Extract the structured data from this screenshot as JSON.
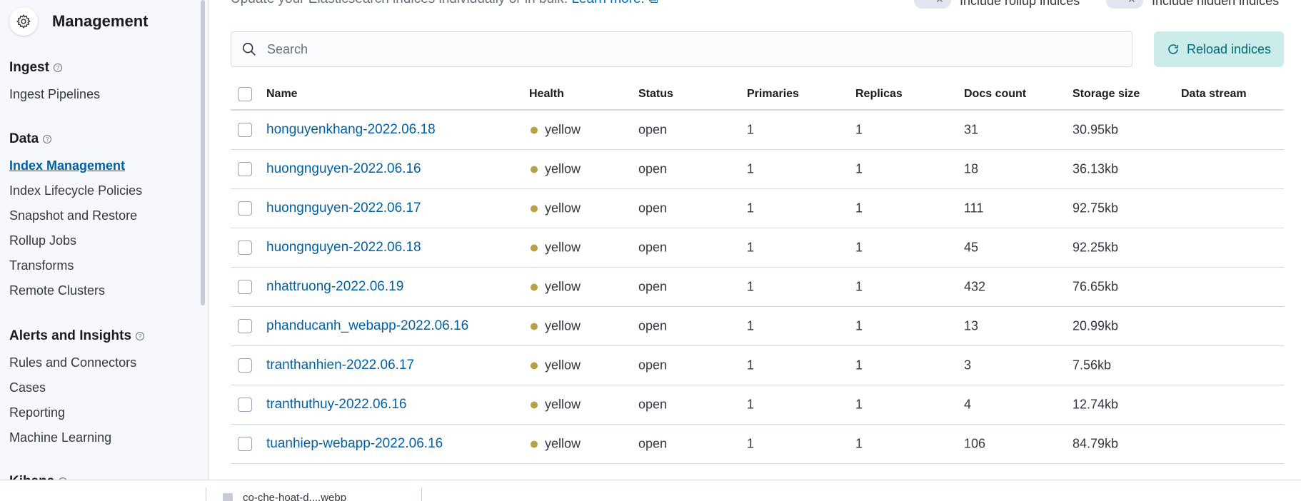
{
  "sidebar": {
    "title": "Management",
    "sections": [
      {
        "label": "Ingest",
        "items": [
          "Ingest Pipelines"
        ]
      },
      {
        "label": "Data",
        "items": [
          "Index Management",
          "Index Lifecycle Policies",
          "Snapshot and Restore",
          "Rollup Jobs",
          "Transforms",
          "Remote Clusters"
        ]
      },
      {
        "label": "Alerts and Insights",
        "items": [
          "Rules and Connectors",
          "Cases",
          "Reporting",
          "Machine Learning"
        ]
      },
      {
        "label": "Kibana",
        "items": []
      }
    ],
    "active_item": "Index Management"
  },
  "header": {
    "description": "Update your Elasticsearch indices individually or in bulk.",
    "learn_more": "Learn more.",
    "toggle_rollup": "Include rollup indices",
    "toggle_hidden": "Include hidden indices"
  },
  "search": {
    "placeholder": "Search"
  },
  "reload_button": "Reload indices",
  "table": {
    "columns": [
      "Name",
      "Health",
      "Status",
      "Primaries",
      "Replicas",
      "Docs count",
      "Storage size",
      "Data stream"
    ],
    "rows": [
      {
        "name": "honguyenkhang-2022.06.18",
        "health": "yellow",
        "status": "open",
        "primaries": "1",
        "replicas": "1",
        "docs": "31",
        "size": "30.95kb",
        "stream": ""
      },
      {
        "name": "huongnguyen-2022.06.16",
        "health": "yellow",
        "status": "open",
        "primaries": "1",
        "replicas": "1",
        "docs": "18",
        "size": "36.13kb",
        "stream": ""
      },
      {
        "name": "huongnguyen-2022.06.17",
        "health": "yellow",
        "status": "open",
        "primaries": "1",
        "replicas": "1",
        "docs": "111",
        "size": "92.75kb",
        "stream": ""
      },
      {
        "name": "huongnguyen-2022.06.18",
        "health": "yellow",
        "status": "open",
        "primaries": "1",
        "replicas": "1",
        "docs": "45",
        "size": "92.25kb",
        "stream": ""
      },
      {
        "name": "nhattruong-2022.06.19",
        "health": "yellow",
        "status": "open",
        "primaries": "1",
        "replicas": "1",
        "docs": "432",
        "size": "76.65kb",
        "stream": ""
      },
      {
        "name": "phanducanh_webapp-2022.06.16",
        "health": "yellow",
        "status": "open",
        "primaries": "1",
        "replicas": "1",
        "docs": "13",
        "size": "20.99kb",
        "stream": ""
      },
      {
        "name": "tranthanhien-2022.06.17",
        "health": "yellow",
        "status": "open",
        "primaries": "1",
        "replicas": "1",
        "docs": "3",
        "size": "7.56kb",
        "stream": ""
      },
      {
        "name": "tranthuthuy-2022.06.16",
        "health": "yellow",
        "status": "open",
        "primaries": "1",
        "replicas": "1",
        "docs": "4",
        "size": "12.74kb",
        "stream": ""
      },
      {
        "name": "tuanhiep-webapp-2022.06.16",
        "health": "yellow",
        "status": "open",
        "primaries": "1",
        "replicas": "1",
        "docs": "106",
        "size": "84.79kb",
        "stream": ""
      }
    ]
  },
  "download_bar": {
    "file": "co-che-hoat-d....webp"
  },
  "colors": {
    "health_yellow": "#b9a046",
    "link": "#0061a6",
    "accent_button_bg": "#ccecec"
  }
}
